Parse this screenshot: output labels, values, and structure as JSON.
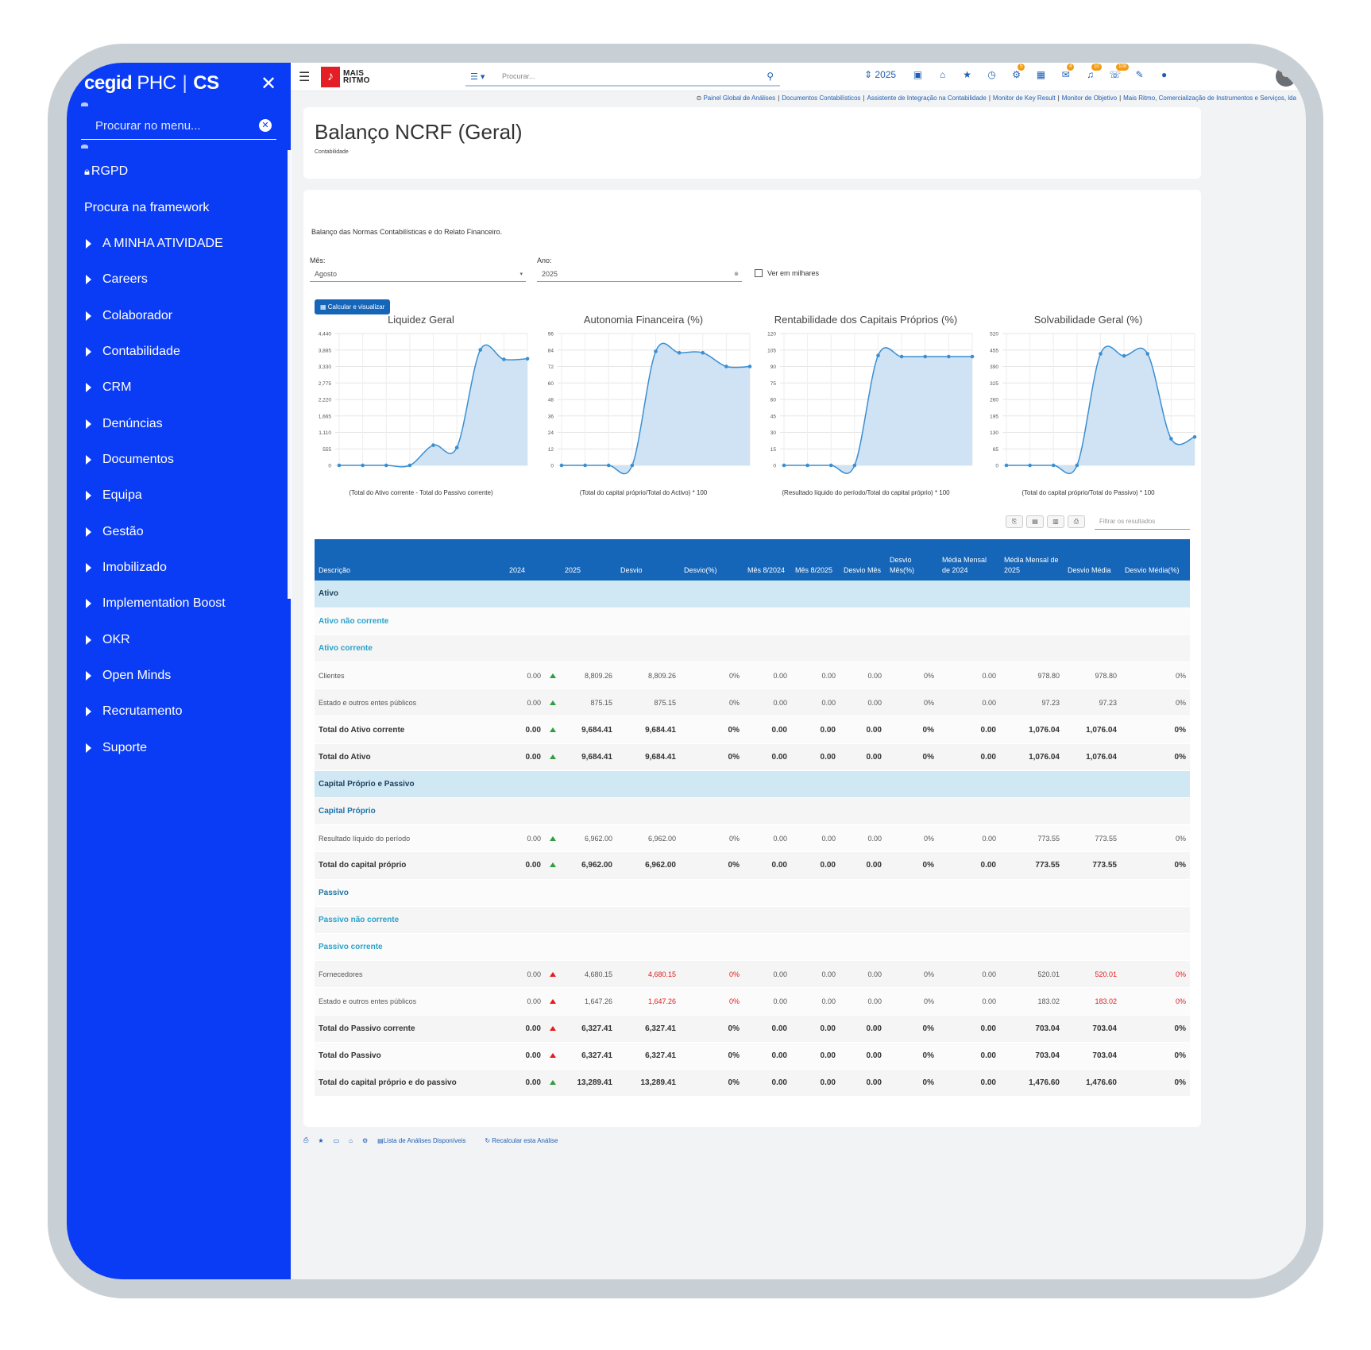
{
  "sidebar": {
    "brand": "cegid",
    "brand_product": "PHC",
    "brand_edition": "CS",
    "search_placeholder": "Procurar no menu...",
    "items": [
      {
        "label": "RGPD",
        "icon": "lock-icon",
        "top": false
      },
      {
        "label": "Procura na framework"
      },
      {
        "label": "A MINHA ATIVIDADE"
      },
      {
        "label": "Careers"
      },
      {
        "label": "Colaborador"
      },
      {
        "label": "Contabilidade"
      },
      {
        "label": "CRM"
      },
      {
        "label": "Denúncias"
      },
      {
        "label": "Documentos"
      },
      {
        "label": "Equipa"
      },
      {
        "label": "Gestão"
      },
      {
        "label": "Imobilizado"
      },
      {
        "label": "Implementation Boost"
      },
      {
        "label": "OKR"
      },
      {
        "label": "Open Minds"
      },
      {
        "label": "Recrutamento"
      },
      {
        "label": "Suporte"
      }
    ]
  },
  "topbar": {
    "logo_line1": "MAIS",
    "logo_line2": "RITMO",
    "search_placeholder": "Procurar...",
    "year": "2025",
    "badges": [
      "5",
      "4",
      "10",
      "108"
    ]
  },
  "links": [
    "Painel Global de Análises",
    "Documentos Contabilísticos",
    "Assistente de Integração na Contabilidade",
    "Monitor de Key Result",
    "Monitor de Objetivo",
    "Mais Ritmo, Comercialização de Instrumentos e Serviços, lda"
  ],
  "page": {
    "title": "Balanço NCRF (Geral)",
    "subtitle": "Contabilidade",
    "description": "Balanço das Normas Contabilísticas e do Relato Financeiro.",
    "month_label": "Mês:",
    "month_value": "Agosto",
    "year_label": "Ano:",
    "year_value": "2025",
    "thousands_label": "Ver em milhares",
    "calc_button": "Calcular e visualizar",
    "filter_placeholder": "Filtrar os resultados"
  },
  "chart_data": [
    {
      "type": "area",
      "title": "Liquidez Geral",
      "xlabel": "(Total do Ativo corrente - Total do Passivo corrente)",
      "ylim": [
        0,
        4440
      ],
      "yticks": [
        0,
        555,
        1110,
        1665,
        2220,
        2775,
        3330,
        3885,
        4440
      ],
      "ytick_labels": [
        "0",
        "555",
        "1,110",
        "1,665",
        "2,220",
        "2,775",
        "3,330",
        "3,885",
        "4,440"
      ],
      "values": [
        0,
        0,
        0,
        0,
        680,
        600,
        3890,
        3570,
        3590
      ]
    },
    {
      "type": "area",
      "title": "Autonomia Financeira (%)",
      "xlabel": "(Total do capital próprio/Total do Activo) * 100",
      "ylim": [
        0,
        96
      ],
      "yticks": [
        0,
        12,
        24,
        36,
        48,
        60,
        72,
        84,
        96
      ],
      "ytick_labels": [
        "0",
        "12",
        "24",
        "36",
        "48",
        "60",
        "72",
        "84",
        "96"
      ],
      "values": [
        0,
        0,
        0,
        0,
        83,
        82,
        82,
        72,
        72
      ]
    },
    {
      "type": "area",
      "title": "Rentabilidade dos Capitais Próprios (%)",
      "xlabel": "(Resultado líquido do período/Total do capital próprio) * 100",
      "ylim": [
        0,
        120
      ],
      "yticks": [
        0,
        15,
        30,
        45,
        60,
        75,
        90,
        105,
        120
      ],
      "ytick_labels": [
        "0",
        "15",
        "30",
        "45",
        "60",
        "75",
        "90",
        "105",
        "120"
      ],
      "values": [
        0,
        0,
        0,
        0,
        100,
        99,
        99,
        99,
        99
      ]
    },
    {
      "type": "area",
      "title": "Solvabilidade Geral (%)",
      "xlabel": "(Total do capital próprio/Total do Passivo) * 100",
      "ylim": [
        0,
        520
      ],
      "yticks": [
        0,
        65,
        130,
        195,
        260,
        325,
        390,
        455,
        520
      ],
      "ytick_labels": [
        "0",
        "65",
        "130",
        "195",
        "260",
        "325",
        "390",
        "455",
        "520"
      ],
      "values": [
        0,
        0,
        0,
        0,
        440,
        432,
        440,
        105,
        112
      ]
    }
  ],
  "table": {
    "headers": [
      "Descrição",
      "2024",
      "",
      "2025",
      "Desvio",
      "Desvio(%)",
      "Mês 8/2024",
      "Mês 8/2025",
      "Desvio Mês",
      "Desvio Mês(%)",
      "Média Mensal de 2024",
      "Média Mensal de 2025",
      "Desvio Média",
      "Desvio Média(%)"
    ],
    "rows": [
      {
        "kind": "sec",
        "cells": [
          "Ativo"
        ]
      },
      {
        "kind": "sub",
        "cells": [
          "Ativo não corrente"
        ]
      },
      {
        "kind": "sub",
        "cells": [
          "Ativo corrente"
        ]
      },
      {
        "kind": "line",
        "trend": "up",
        "cells": [
          "Clientes",
          "0.00",
          "",
          "8,809.26",
          "8,809.26",
          "0%",
          "0.00",
          "0.00",
          "0.00",
          "0%",
          "0.00",
          "978.80",
          "978.80",
          "0%"
        ]
      },
      {
        "kind": "line",
        "trend": "up",
        "cells": [
          "Estado e outros entes públicos",
          "0.00",
          "",
          "875.15",
          "875.15",
          "0%",
          "0.00",
          "0.00",
          "0.00",
          "0%",
          "0.00",
          "97.23",
          "97.23",
          "0%"
        ]
      },
      {
        "kind": "tot",
        "trend": "up",
        "cells": [
          "Total do Ativo corrente",
          "0.00",
          "",
          "9,684.41",
          "9,684.41",
          "0%",
          "0.00",
          "0.00",
          "0.00",
          "0%",
          "0.00",
          "1,076.04",
          "1,076.04",
          "0%"
        ]
      },
      {
        "kind": "tot",
        "trend": "up",
        "cells": [
          "Total do Ativo",
          "0.00",
          "",
          "9,684.41",
          "9,684.41",
          "0%",
          "0.00",
          "0.00",
          "0.00",
          "0%",
          "0.00",
          "1,076.04",
          "1,076.04",
          "0%"
        ]
      },
      {
        "kind": "sec",
        "cells": [
          "Capital Próprio e Passivo"
        ]
      },
      {
        "kind": "subd",
        "cells": [
          "Capital Próprio"
        ]
      },
      {
        "kind": "line",
        "trend": "up",
        "cells": [
          "Resultado líquido do período",
          "0.00",
          "",
          "6,962.00",
          "6,962.00",
          "0%",
          "0.00",
          "0.00",
          "0.00",
          "0%",
          "0.00",
          "773.55",
          "773.55",
          "0%"
        ]
      },
      {
        "kind": "tot",
        "trend": "up",
        "cells": [
          "Total do capital próprio",
          "0.00",
          "",
          "6,962.00",
          "6,962.00",
          "0%",
          "0.00",
          "0.00",
          "0.00",
          "0%",
          "0.00",
          "773.55",
          "773.55",
          "0%"
        ]
      },
      {
        "kind": "subd",
        "cells": [
          "Passivo"
        ]
      },
      {
        "kind": "sub",
        "cells": [
          "Passivo não corrente"
        ]
      },
      {
        "kind": "sub",
        "cells": [
          "Passivo corrente"
        ]
      },
      {
        "kind": "line",
        "trend": "down",
        "red": true,
        "cells": [
          "Fornecedores",
          "0.00",
          "",
          "4,680.15",
          "4,680.15",
          "0%",
          "0.00",
          "0.00",
          "0.00",
          "0%",
          "0.00",
          "520.01",
          "520.01",
          "0%"
        ]
      },
      {
        "kind": "line",
        "trend": "down",
        "red": true,
        "cells": [
          "Estado e outros entes públicos",
          "0.00",
          "",
          "1,647.26",
          "1,647.26",
          "0%",
          "0.00",
          "0.00",
          "0.00",
          "0%",
          "0.00",
          "183.02",
          "183.02",
          "0%"
        ]
      },
      {
        "kind": "tot",
        "trend": "down",
        "cells": [
          "Total do Passivo corrente",
          "0.00",
          "",
          "6,327.41",
          "6,327.41",
          "0%",
          "0.00",
          "0.00",
          "0.00",
          "0%",
          "0.00",
          "703.04",
          "703.04",
          "0%"
        ]
      },
      {
        "kind": "tot",
        "trend": "down",
        "cells": [
          "Total do Passivo",
          "0.00",
          "",
          "6,327.41",
          "6,327.41",
          "0%",
          "0.00",
          "0.00",
          "0.00",
          "0%",
          "0.00",
          "703.04",
          "703.04",
          "0%"
        ]
      },
      {
        "kind": "tot",
        "trend": "up",
        "cells": [
          "Total do capital próprio e do passivo",
          "0.00",
          "",
          "13,289.41",
          "13,289.41",
          "0%",
          "0.00",
          "0.00",
          "0.00",
          "0%",
          "0.00",
          "1,476.60",
          "1,476.60",
          "0%"
        ]
      }
    ]
  },
  "footer": {
    "list_label": "Lista de Análises Disponíveis",
    "recalc_label": "Recalcular esta Análise"
  },
  "colors": {
    "sidebar": "#0b3cf5",
    "header": "#1565b8",
    "section": "#cfe8f3",
    "chart_line": "#3b8fd1",
    "chart_fill": "#cfe3f5",
    "up": "#2e9e3e",
    "down": "#e41a1c"
  }
}
